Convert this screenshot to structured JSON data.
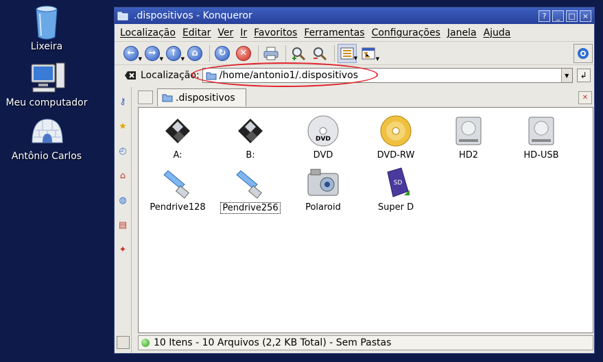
{
  "desktop": {
    "icons": [
      {
        "label": "Lixeira",
        "icon": "trash-icon"
      },
      {
        "label": "Meu computador",
        "icon": "computer-icon"
      },
      {
        "label": "Antônio Carlos",
        "icon": "igloo-home-icon"
      }
    ]
  },
  "window": {
    "title": ".dispositivos - Konqueror",
    "controls": [
      "?",
      "_",
      "□",
      "×"
    ]
  },
  "menubar": [
    "Localização",
    "Editar",
    "Ver",
    "Ir",
    "Favoritos",
    "Ferramentas",
    "Configurações",
    "Janela",
    "Ajuda"
  ],
  "location": {
    "label": "Localização:",
    "url": "/home/antonio1/.dispositivos"
  },
  "tab": {
    "label": ".dispositivos"
  },
  "files": [
    {
      "label": "A:",
      "icon": "floppy-icon"
    },
    {
      "label": "B:",
      "icon": "floppy-icon"
    },
    {
      "label": "DVD",
      "icon": "dvd-icon"
    },
    {
      "label": "DVD-RW",
      "icon": "dvd-rw-icon"
    },
    {
      "label": "HD2",
      "icon": "harddisk-icon"
    },
    {
      "label": "HD-USB",
      "icon": "harddisk-icon"
    },
    {
      "label": "Pendrive128",
      "icon": "usb-pendrive-icon"
    },
    {
      "label": "Pendrive256",
      "icon": "usb-pendrive-icon"
    },
    {
      "label": "Polaroid",
      "icon": "camera-icon"
    },
    {
      "label": "Super D",
      "icon": "sd-card-icon"
    }
  ],
  "status": {
    "text": "10 Itens - 10 Arquivos (2,2 KB Total) - Sem Pastas"
  },
  "colors": {
    "desktop": "#0d1a4a",
    "titlebar": "#3c5fbf",
    "highlight_ellipse": "#e0202a"
  }
}
